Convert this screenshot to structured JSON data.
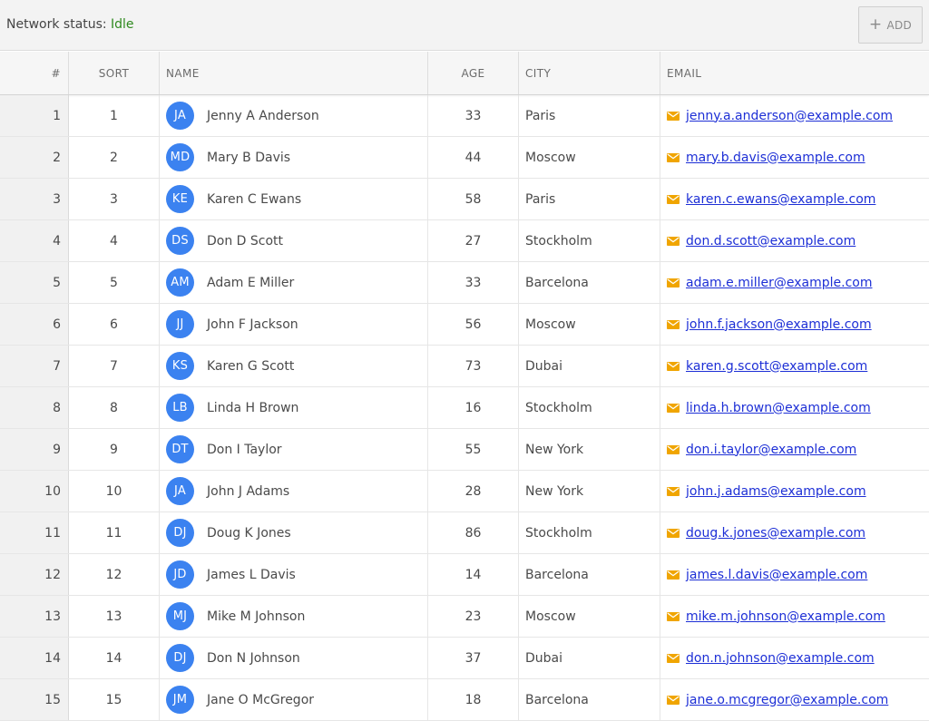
{
  "toolbar": {
    "status_label": "Network status:",
    "status_value": "Idle",
    "status_color": "#2f8a1f",
    "add_label": "ADD",
    "add_icon": "plus-icon"
  },
  "colors": {
    "avatar": "#3b82f0",
    "mail_icon": "#f0a500",
    "link": "#1d2fd6"
  },
  "grid": {
    "columns": [
      "#",
      "SORT",
      "NAME",
      "AGE",
      "CITY",
      "EMAIL"
    ],
    "rows": [
      {
        "idx": "1",
        "sort": "1",
        "initials": "JA",
        "name": "Jenny A Anderson",
        "age": "33",
        "city": "Paris",
        "email": "jenny.a.anderson@example.com"
      },
      {
        "idx": "2",
        "sort": "2",
        "initials": "MD",
        "name": "Mary B Davis",
        "age": "44",
        "city": "Moscow",
        "email": "mary.b.davis@example.com"
      },
      {
        "idx": "3",
        "sort": "3",
        "initials": "KE",
        "name": "Karen C Ewans",
        "age": "58",
        "city": "Paris",
        "email": "karen.c.ewans@example.com"
      },
      {
        "idx": "4",
        "sort": "4",
        "initials": "DS",
        "name": "Don D Scott",
        "age": "27",
        "city": "Stockholm",
        "email": "don.d.scott@example.com"
      },
      {
        "idx": "5",
        "sort": "5",
        "initials": "AM",
        "name": "Adam E Miller",
        "age": "33",
        "city": "Barcelona",
        "email": "adam.e.miller@example.com"
      },
      {
        "idx": "6",
        "sort": "6",
        "initials": "JJ",
        "name": "John F Jackson",
        "age": "56",
        "city": "Moscow",
        "email": "john.f.jackson@example.com"
      },
      {
        "idx": "7",
        "sort": "7",
        "initials": "KS",
        "name": "Karen G Scott",
        "age": "73",
        "city": "Dubai",
        "email": "karen.g.scott@example.com"
      },
      {
        "idx": "8",
        "sort": "8",
        "initials": "LB",
        "name": "Linda H Brown",
        "age": "16",
        "city": "Stockholm",
        "email": "linda.h.brown@example.com"
      },
      {
        "idx": "9",
        "sort": "9",
        "initials": "DT",
        "name": "Don I Taylor",
        "age": "55",
        "city": "New York",
        "email": "don.i.taylor@example.com"
      },
      {
        "idx": "10",
        "sort": "10",
        "initials": "JA",
        "name": "John J Adams",
        "age": "28",
        "city": "New York",
        "email": "john.j.adams@example.com"
      },
      {
        "idx": "11",
        "sort": "11",
        "initials": "DJ",
        "name": "Doug K Jones",
        "age": "86",
        "city": "Stockholm",
        "email": "doug.k.jones@example.com"
      },
      {
        "idx": "12",
        "sort": "12",
        "initials": "JD",
        "name": "James L Davis",
        "age": "14",
        "city": "Barcelona",
        "email": "james.l.davis@example.com"
      },
      {
        "idx": "13",
        "sort": "13",
        "initials": "MJ",
        "name": "Mike M Johnson",
        "age": "23",
        "city": "Moscow",
        "email": "mike.m.johnson@example.com"
      },
      {
        "idx": "14",
        "sort": "14",
        "initials": "DJ",
        "name": "Don N Johnson",
        "age": "37",
        "city": "Dubai",
        "email": "don.n.johnson@example.com"
      },
      {
        "idx": "15",
        "sort": "15",
        "initials": "JM",
        "name": "Jane O McGregor",
        "age": "18",
        "city": "Barcelona",
        "email": "jane.o.mcgregor@example.com"
      }
    ]
  }
}
